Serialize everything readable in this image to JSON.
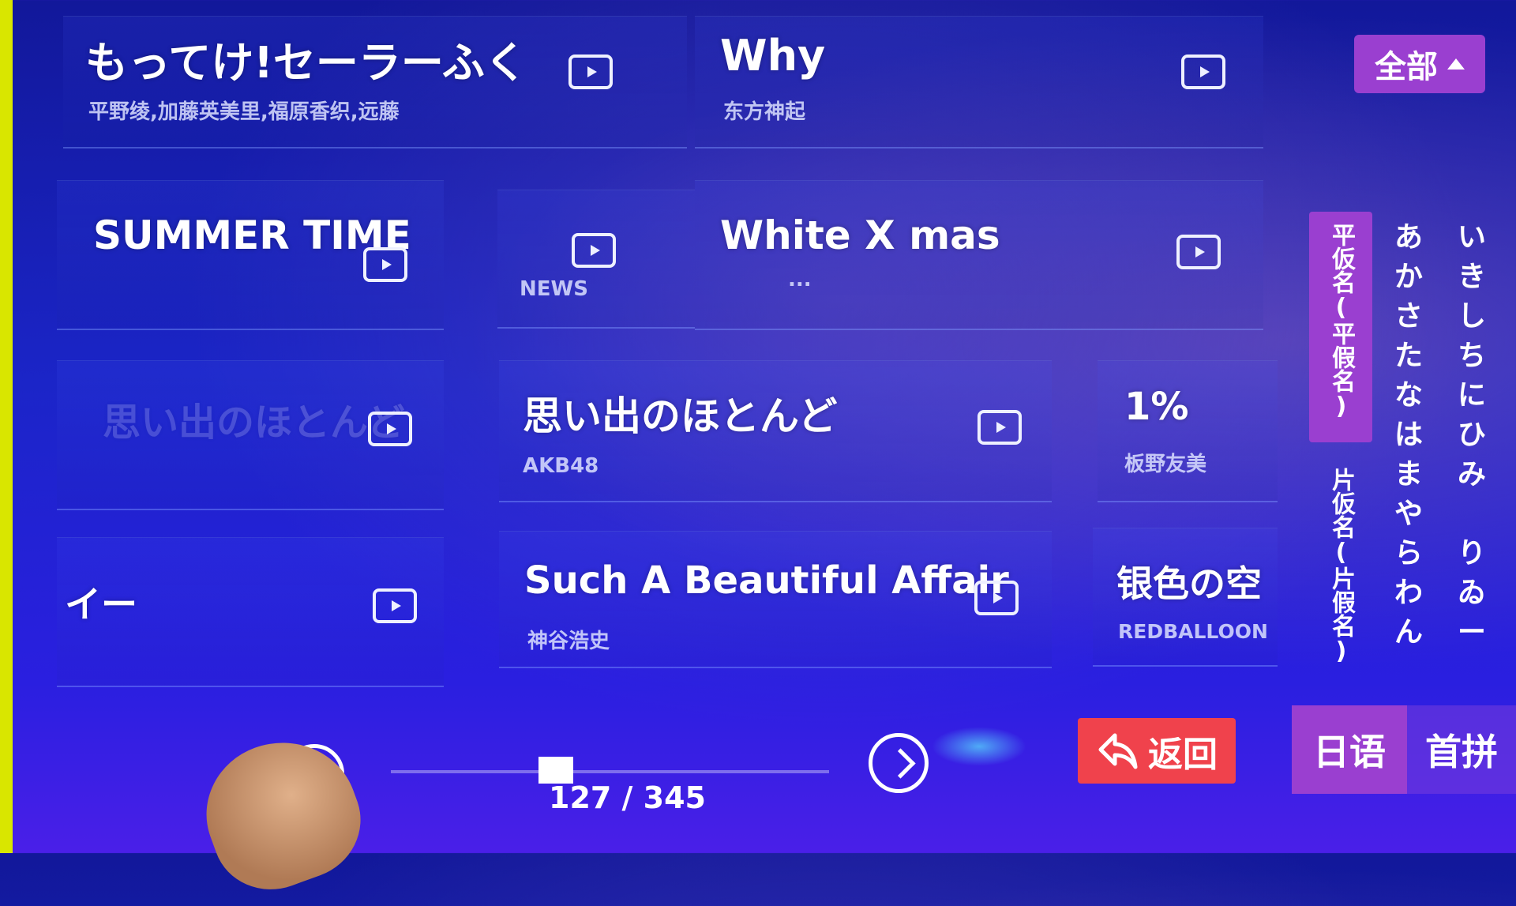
{
  "filter": {
    "all_label": "全部"
  },
  "songs": [
    {
      "title": "もってけ!セーラーふく",
      "artist": "平野绫,加藤英美里,福原香织,远藤"
    },
    {
      "title": "Why",
      "artist": "东方神起"
    },
    {
      "title": "SUMMER TIME",
      "artist": ""
    },
    {
      "title": "",
      "artist": "NEWS"
    },
    {
      "title": "White X mas",
      "artist": "..."
    },
    {
      "title": "思い出のほとんど",
      "artist": ""
    },
    {
      "title": "思い出のほとんど",
      "artist": "AKB48"
    },
    {
      "title": "1%",
      "artist": "板野友美"
    },
    {
      "title": "イー",
      "artist": ""
    },
    {
      "title": "Such A Beautiful Affair",
      "artist": "神谷浩史"
    },
    {
      "title": "银色の空",
      "artist": "REDBALLOON"
    }
  ],
  "sidebar": {
    "tab_hiragana": "平仮名(平假名)",
    "tab_katakana": "片仮名(片假名)",
    "kana_col1": [
      "あ",
      "か",
      "さ",
      "た",
      "な",
      "は",
      "ま",
      "や",
      "ら",
      "わ",
      "ん"
    ],
    "kana_col2": [
      "い",
      "き",
      "し",
      "ち",
      "に",
      "ひ",
      "み",
      "",
      "り",
      "ゐ",
      "ー"
    ]
  },
  "language_tabs": {
    "japanese": "日语",
    "pinyin": "首拼"
  },
  "back_label": "返回",
  "pagination": {
    "current": 127,
    "total": 345,
    "text": "127 / 345"
  }
}
